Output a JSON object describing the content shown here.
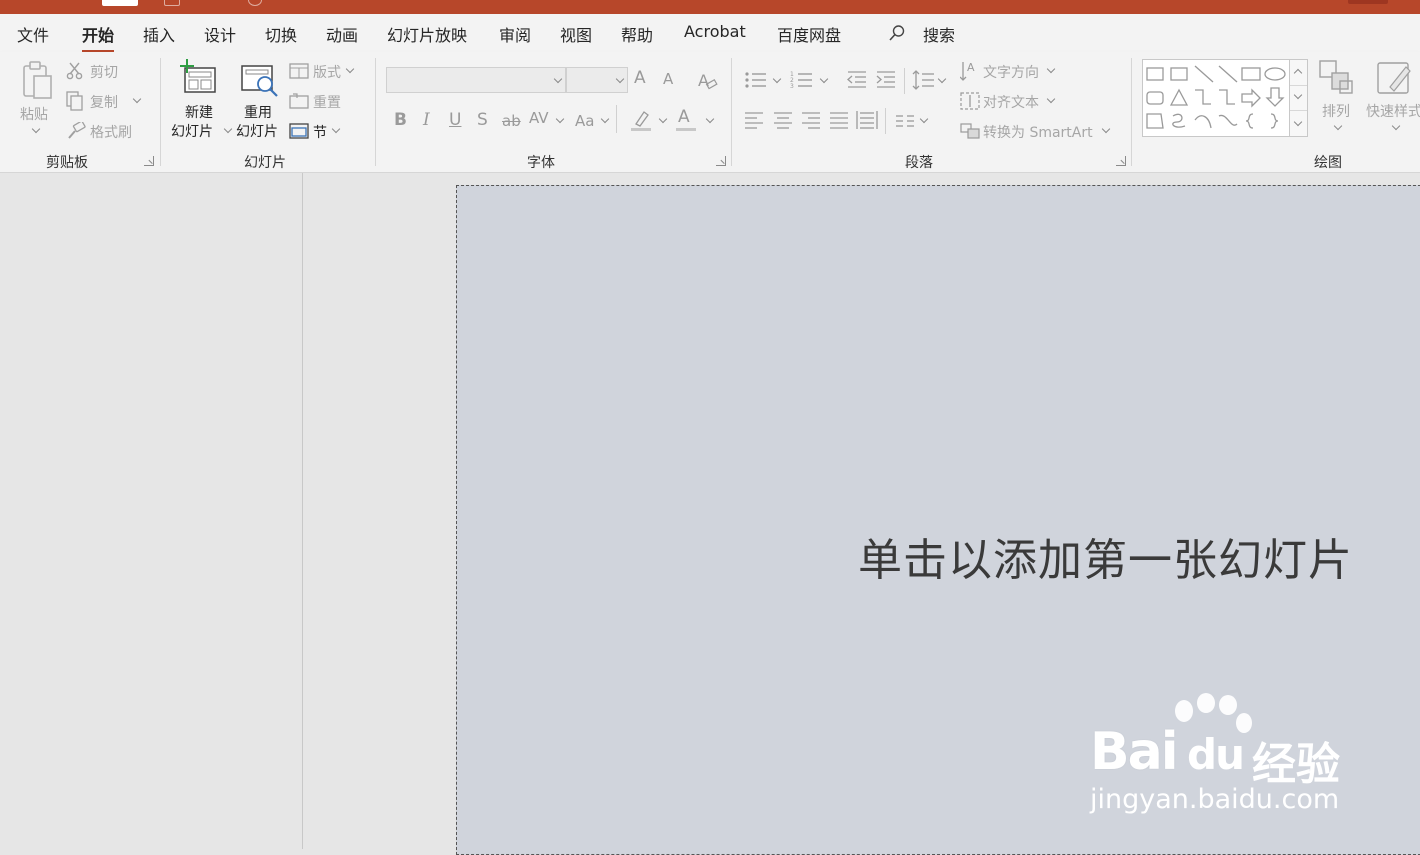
{
  "colors": {
    "accent": "#b7472a",
    "slide_bg": "#d0d4dc",
    "ribbon_bg": "#f3f3f3"
  },
  "menu": {
    "file": "文件",
    "home": "开始",
    "insert": "插入",
    "design": "设计",
    "transitions": "切换",
    "animations": "动画",
    "slideshow": "幻灯片放映",
    "review": "审阅",
    "view": "视图",
    "help": "帮助",
    "acrobat": "Acrobat",
    "baidu_netdisk": "百度网盘",
    "search": "搜索"
  },
  "clipboard": {
    "paste": "粘贴",
    "cut": "剪切",
    "copy": "复制",
    "format_painter": "格式刷",
    "group_label": "剪贴板"
  },
  "slides": {
    "new_slide_line1": "新建",
    "new_slide_line2": "幻灯片",
    "reuse_line1": "重用",
    "reuse_line2": "幻灯片",
    "layout": "版式",
    "reset": "重置",
    "section": "节",
    "group_label": "幻灯片"
  },
  "font": {
    "group_label": "字体",
    "bold": "B",
    "italic": "I",
    "underline": "U",
    "shadow": "S",
    "strike": "ab",
    "spacing": "AV",
    "change_case": "Aa",
    "grow": "A",
    "shrink": "A",
    "font_color": "A"
  },
  "paragraph": {
    "group_label": "段落",
    "text_direction": "文字方向",
    "align_text": "对齐文本",
    "smartart": "转换为 SmartArt"
  },
  "drawing": {
    "group_label": "绘图",
    "arrange": "排列",
    "quick_styles": "快速样式"
  },
  "slide": {
    "title_placeholder": "单击以添加第一张幻灯片"
  },
  "watermark": {
    "brand_a": "Bai",
    "brand_b": "du",
    "brand_c": "经验",
    "url": "jingyan.baidu.com"
  }
}
